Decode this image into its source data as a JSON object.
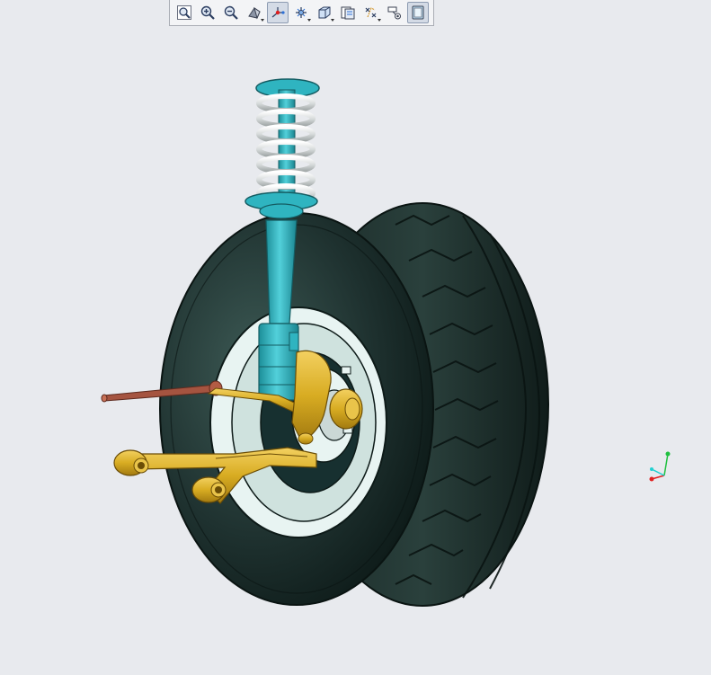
{
  "toolbar": {
    "buttons": [
      {
        "id": "refit",
        "icon": "zoom-fit-icon",
        "active": false,
        "dropdown": false
      },
      {
        "id": "zoom-in",
        "icon": "zoom-in-icon",
        "active": false,
        "dropdown": false
      },
      {
        "id": "zoom-out",
        "icon": "zoom-out-icon",
        "active": false,
        "dropdown": false
      },
      {
        "id": "display-style",
        "icon": "shading-icon",
        "active": false,
        "dropdown": true
      },
      {
        "id": "datum-display",
        "icon": "datum-display-icon",
        "active": true,
        "dropdown": false
      },
      {
        "id": "named-views",
        "icon": "named-views-icon",
        "active": false,
        "dropdown": true
      },
      {
        "id": "saved-orientations",
        "icon": "view-cube-icon",
        "active": false,
        "dropdown": true
      },
      {
        "id": "view-manager",
        "icon": "view-manager-icon",
        "active": false,
        "dropdown": false
      },
      {
        "id": "datum-points",
        "icon": "datum-points-icon",
        "active": false,
        "dropdown": true
      },
      {
        "id": "annotations",
        "icon": "annotations-icon",
        "active": false,
        "dropdown": false
      },
      {
        "id": "appearance",
        "icon": "appearance-icon",
        "active": true,
        "dropdown": false
      }
    ]
  },
  "model": {
    "colors": {
      "tire": "#1f3230",
      "rim": "#e8f4f2",
      "strut": "#2fb4c0",
      "spring": "#e4e6e6",
      "control_arm": "#d8ac22",
      "tie_rod": "#a55440",
      "background": "#e8eaee"
    }
  },
  "triad": {
    "x_color": "#e02020",
    "y_color": "#20c040",
    "z_color": "#20d0d0"
  }
}
